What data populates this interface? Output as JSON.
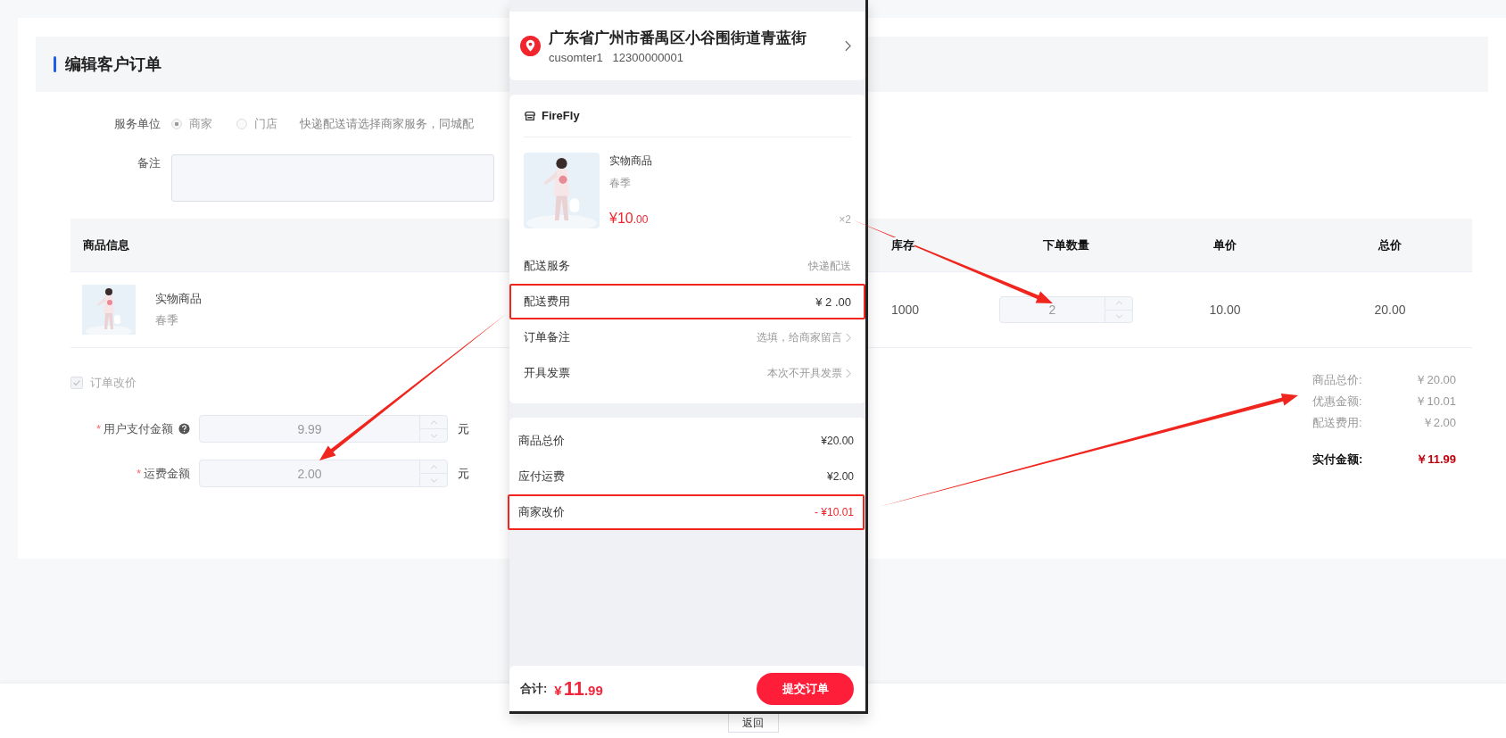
{
  "page": {
    "title": "编辑客户订单"
  },
  "service_unit": {
    "label": "服务单位",
    "options": [
      {
        "label": "商家",
        "selected": true
      },
      {
        "label": "门店",
        "selected": false
      }
    ],
    "hint": "快递配送请选择商家服务，同城配"
  },
  "remark": {
    "label": "备注"
  },
  "table": {
    "columns": [
      "商品信息",
      "库存",
      "下单数量",
      "单价",
      "总价"
    ],
    "rows": [
      {
        "name": "实物商品",
        "spec": "春季",
        "stock": "1000",
        "quantity": "2",
        "unit_price": "10.00",
        "total": "20.00"
      }
    ]
  },
  "price_edit": {
    "label": "订单改价",
    "checked": true,
    "disabled": true
  },
  "fields": [
    {
      "required_mark": "*",
      "label": "用户支付金额",
      "help": true,
      "value": "9.99",
      "unit": "元"
    },
    {
      "required_mark": "*",
      "label": "运费金额",
      "value": "2.00",
      "unit": "元"
    }
  ],
  "summary": [
    {
      "label": "商品总价:",
      "value": "￥20.00"
    },
    {
      "label": "优惠金额:",
      "value": "￥10.01"
    },
    {
      "label": "配送费用:",
      "value": "￥2.00"
    }
  ],
  "summary_total": {
    "label": "实付金额:",
    "value": "￥11.99"
  },
  "footer": {
    "back_button": "返回"
  },
  "preview": {
    "address": "广东省广州市番禺区小谷围街道青蓝街",
    "contact": "cusomter1   12300000001",
    "store": "FireFly",
    "product": {
      "name": "实物商品",
      "spec": "春季",
      "price": "¥10",
      "price_decimals": ".00",
      "count": "×2"
    },
    "rows": [
      {
        "label": "配送服务",
        "value": "快递配送"
      },
      {
        "label": "配送费用",
        "value": "¥ 2 .00",
        "highlighted": true
      },
      {
        "label": "订单备注",
        "value": "选填，给商家留言",
        "chevron": true
      },
      {
        "label": "开具发票",
        "value": "本次不开具发票",
        "chevron": true
      }
    ],
    "totals": [
      {
        "label": "商品总价",
        "value": "¥20.00"
      },
      {
        "label": "应付运费",
        "value": "¥2.00"
      },
      {
        "label": "商家改价",
        "value": "- ¥10.01",
        "negative": true,
        "highlighted": true
      }
    ],
    "bottom": {
      "label": "合计:",
      "currency": "¥",
      "amount": "11",
      "decimals": ".99",
      "button": "提交订单"
    }
  }
}
